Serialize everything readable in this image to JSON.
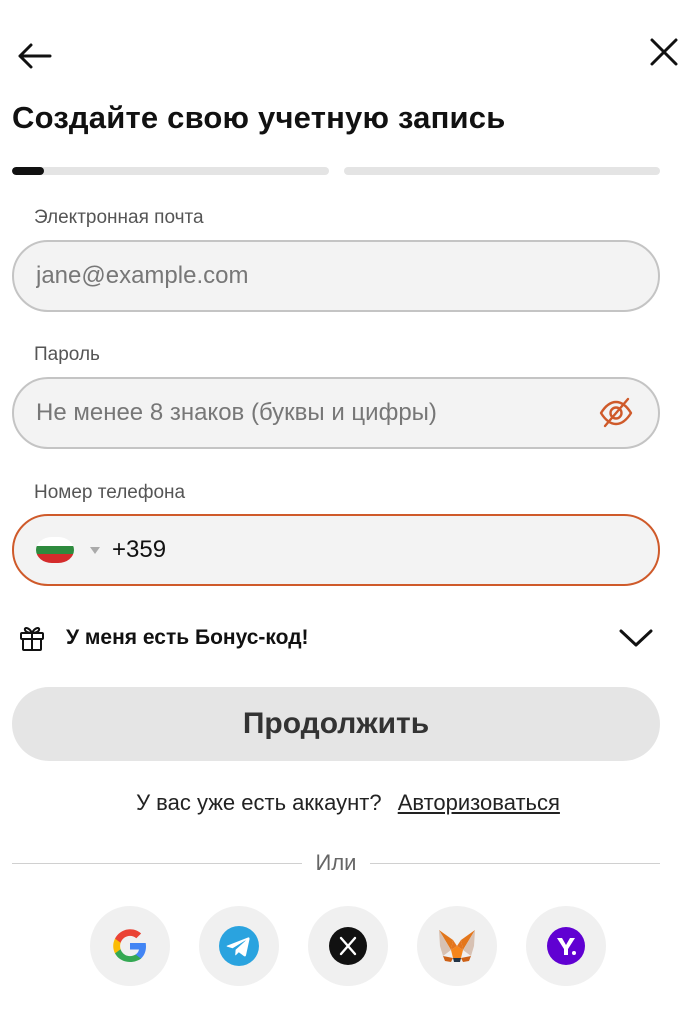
{
  "header": {
    "back_icon": "arrow-left-icon",
    "close_icon": "close-icon"
  },
  "title": "Создайте свою учетную запись",
  "progress": {
    "current_step": 1,
    "total_steps": 2,
    "step_fill": 0.1
  },
  "email": {
    "label": "Электронная почта",
    "placeholder": "jane@example.com",
    "value": ""
  },
  "password": {
    "label": "Пароль",
    "placeholder": "Не менее 8 знаков (буквы и цифры)",
    "value": "",
    "toggle_icon": "eye-off-icon"
  },
  "phone": {
    "label": "Номер телефона",
    "country_flag": "bulgaria-flag",
    "country_code": "+359",
    "value": ""
  },
  "bonus": {
    "label": "У меня есть Бонус-код!",
    "icon": "gift-icon",
    "expand_icon": "chevron-down-icon"
  },
  "continue_label": "Продолжить",
  "login": {
    "prompt": "У вас уже есть аккаунт?",
    "link": "Авторизоваться"
  },
  "divider_label": "Или",
  "social_providers": [
    "google",
    "telegram",
    "x",
    "metamask",
    "yahoo"
  ],
  "colors": {
    "accent": "#cf5a2a",
    "button_bg": "#e5e5e5",
    "field_bg": "#f3f3f3"
  }
}
